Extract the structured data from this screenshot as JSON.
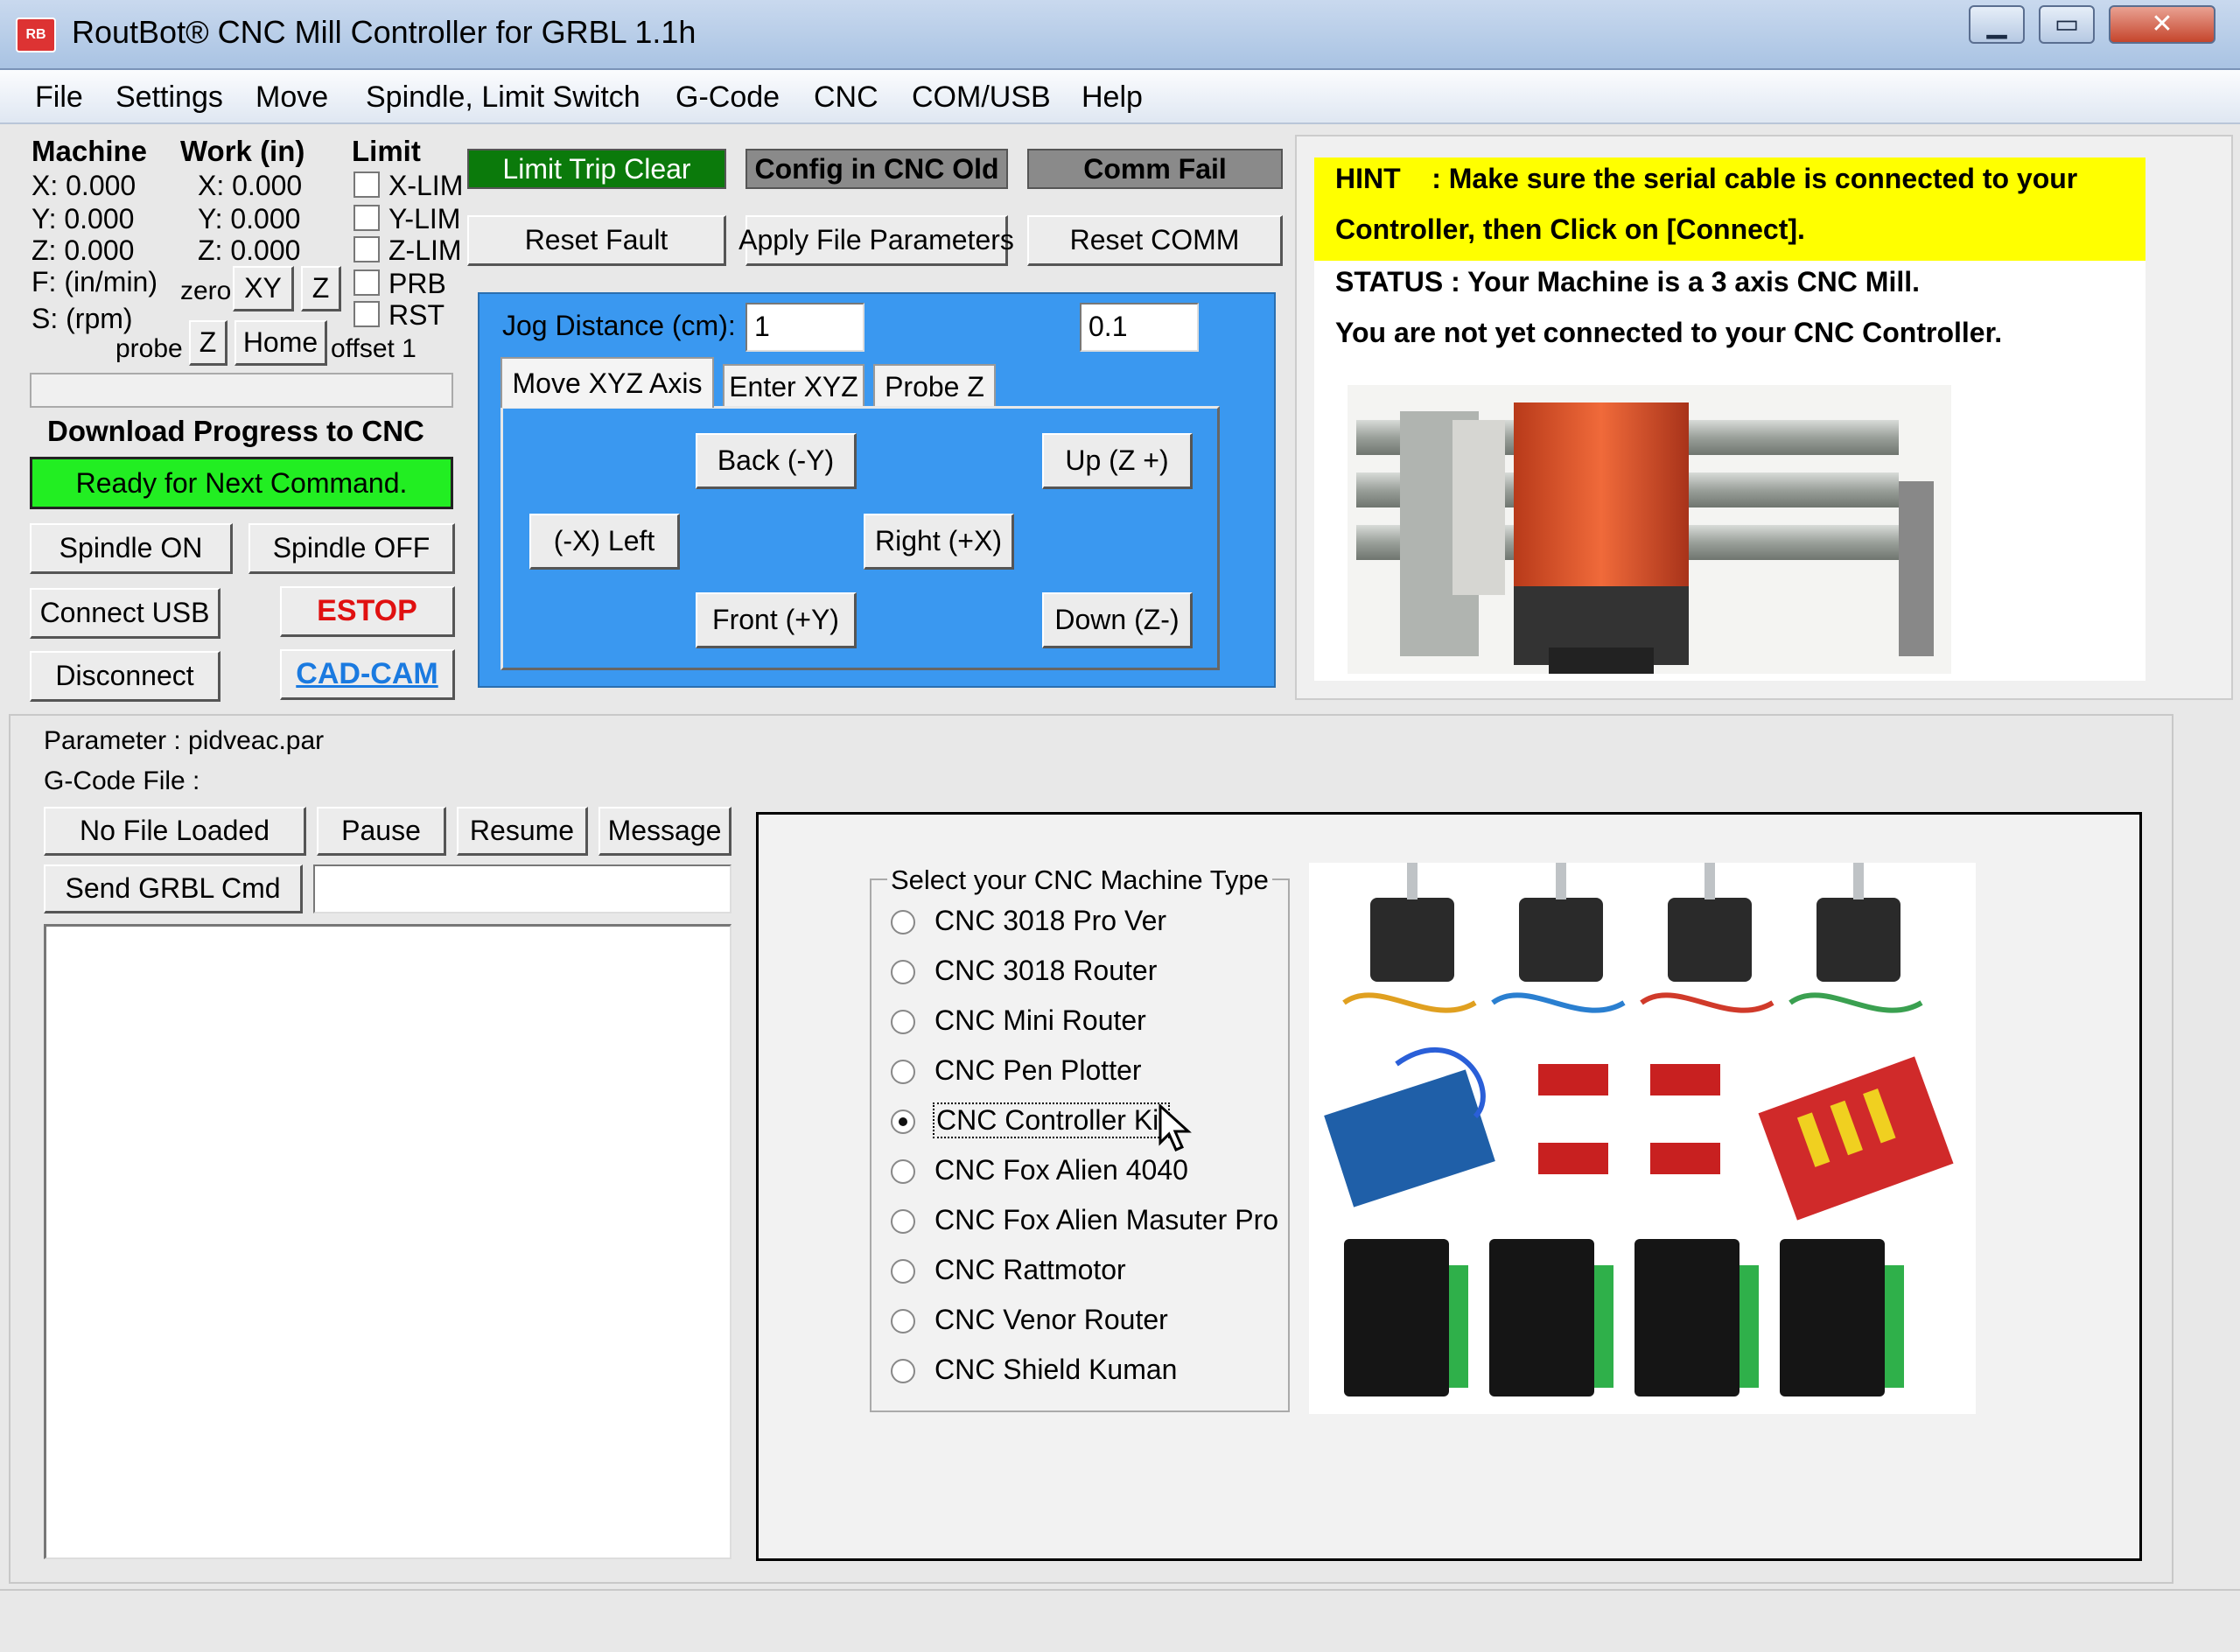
{
  "window": {
    "title": "RoutBot® CNC Mill Controller for GRBL 1.1h",
    "icon_text": "RB",
    "minimize": "▁",
    "maximize": "▭",
    "close": "✕"
  },
  "menu": [
    "File",
    "Settings",
    "Move",
    "Spindle, Limit Switch",
    "G-Code",
    "CNC",
    "COM/USB",
    "Help"
  ],
  "coords": {
    "machine_header": "Machine",
    "work_header": "Work (in)",
    "limit_header": "Limit",
    "machine": [
      "X: 0.000",
      "Y: 0.000",
      "Z: 0.000"
    ],
    "work": [
      "X: 0.000",
      "Y: 0.000",
      "Z: 0.000"
    ],
    "feed": "F: (in/min)",
    "speed": "S: (rpm)",
    "limits": [
      "X-LIM",
      "Y-LIM",
      "Z-LIM",
      "PRB",
      "RST"
    ],
    "zero_label": "zero",
    "zero_xy": "XY",
    "zero_z": "Z",
    "probe_label": "probe",
    "probe_z": "Z",
    "home": "Home",
    "offset": "offset 1"
  },
  "progress": {
    "title": "Download Progress to CNC",
    "status": "Ready for Next Command.",
    "fill": 0
  },
  "controls": {
    "spindle_on": "Spindle ON",
    "spindle_off": "Spindle OFF",
    "connect_usb": "Connect USB",
    "estop": "ESTOP",
    "disconnect": "Disconnect",
    "cadcam": "CAD-CAM"
  },
  "status": {
    "limit_trip": "Limit Trip Clear",
    "config": "Config in CNC Old",
    "comm": "Comm Fail",
    "reset_fault": "Reset Fault",
    "apply_params": "Apply File Parameters",
    "reset_comm": "Reset COMM",
    "colors": {
      "limit": "#0b7a0b",
      "config": "#8a8a8a",
      "comm": "#8a8a8a",
      "jog_bg": "#3a98f0",
      "ready": "#22ee22",
      "hint": "#ffff00"
    }
  },
  "jog": {
    "distance_label": "Jog Distance (cm):",
    "distance_value": "1",
    "step_value": "0.1",
    "tabs": [
      "Move XYZ Axis",
      "Enter XYZ",
      "Probe Z"
    ],
    "back": "Back  (-Y)",
    "up": "Up (Z +)",
    "left": "(-X) Left",
    "right": "Right  (+X)",
    "front": "Front  (+Y)",
    "down": "Down (Z-)"
  },
  "hint": {
    "line1": "HINT    : Make sure the serial cable is connected to your",
    "line2": "Controller, then Click on [Connect].",
    "status1": "STATUS : Your Machine is a 3 axis CNC Mill.",
    "status2": "You are not yet connected to your CNC Controller."
  },
  "file": {
    "parameter": "Parameter : pidveac.par",
    "gcode": "G-Code File :",
    "no_file": "No File Loaded",
    "pause": "Pause",
    "resume": "Resume",
    "message": "Message",
    "send": "Send GRBL Cmd",
    "cmd_value": ""
  },
  "machine_type": {
    "legend": "Select your CNC Machine Type",
    "options": [
      "CNC 3018 Pro Ver",
      "CNC 3018 Router",
      "CNC Mini Router",
      "CNC Pen Plotter",
      "CNC Controller Kit",
      "CNC Fox Alien 4040",
      "CNC Fox Alien Masuter Pro",
      "CNC Rattmotor",
      "CNC Venor Router",
      "CNC Shield Kuman"
    ],
    "selected_index": 4
  }
}
